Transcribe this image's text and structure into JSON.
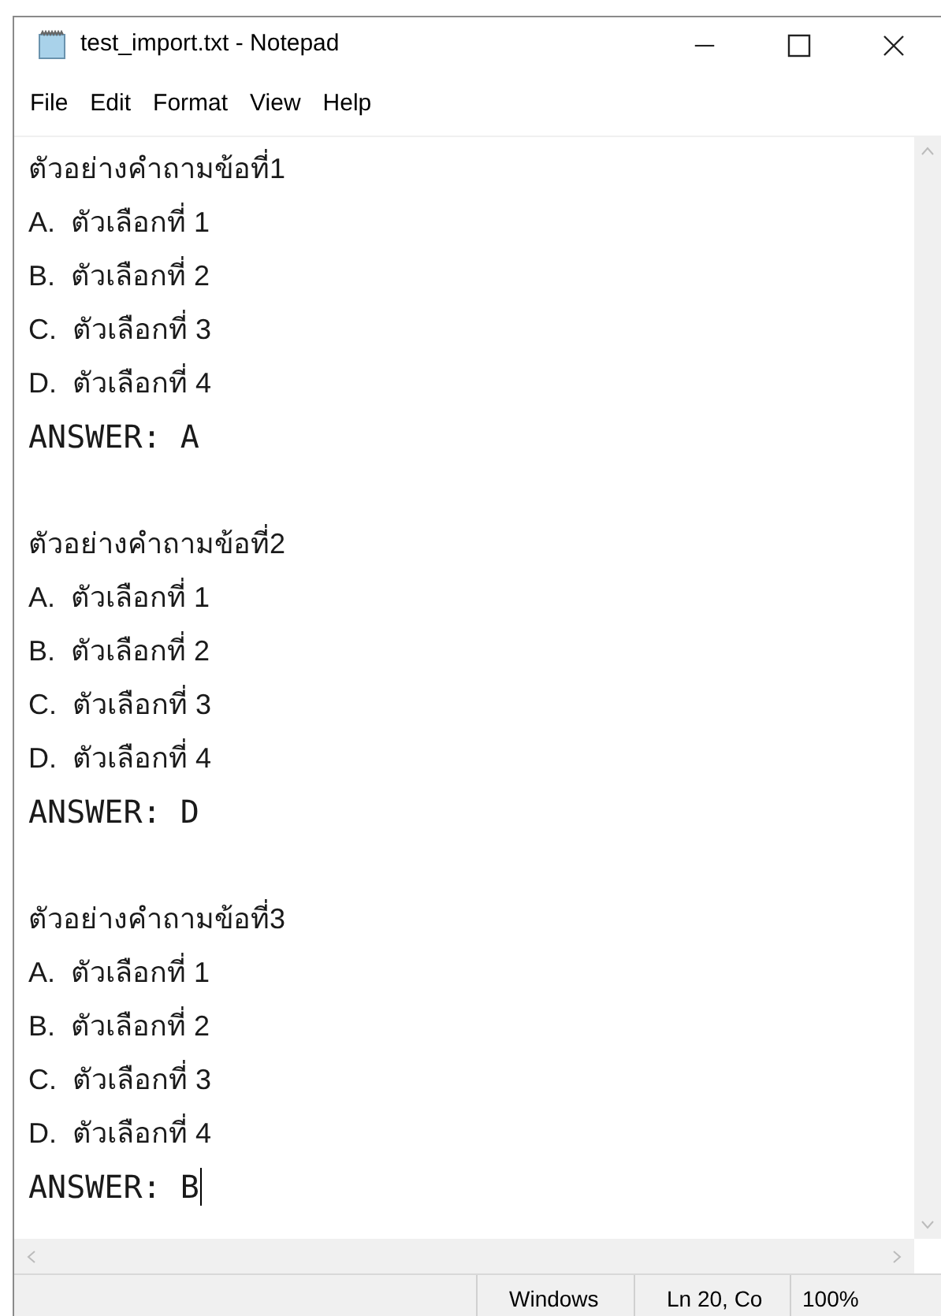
{
  "window": {
    "title": "test_import.txt - Notepad"
  },
  "menu": [
    "File",
    "Edit",
    "Format",
    "View",
    "Help"
  ],
  "questions": [
    {
      "question": "ตัวอย่างคำถามข้อที่1",
      "options": [
        "A.  ตัวเลือกที่ 1",
        "B.  ตัวเลือกที่ 2",
        "C.  ตัวเลือกที่ 3",
        "D.  ตัวเลือกที่ 4"
      ],
      "answer": "ANSWER: A"
    },
    {
      "question": "ตัวอย่างคำถามข้อที่2",
      "options": [
        "A.  ตัวเลือกที่ 1",
        "B.  ตัวเลือกที่ 2",
        "C.  ตัวเลือกที่ 3",
        "D.  ตัวเลือกที่ 4"
      ],
      "answer": "ANSWER: D"
    },
    {
      "question": "ตัวอย่างคำถามข้อที่3",
      "options": [
        "A.  ตัวเลือกที่ 1",
        "B.  ตัวเลือกที่ 2",
        "C.  ตัวเลือกที่ 3",
        "D.  ตัวเลือกที่ 4"
      ],
      "answer": "ANSWER: B"
    }
  ],
  "status_bar": {
    "line_ending": "Windows",
    "position": "Ln 20, Co",
    "zoom": "100%"
  }
}
